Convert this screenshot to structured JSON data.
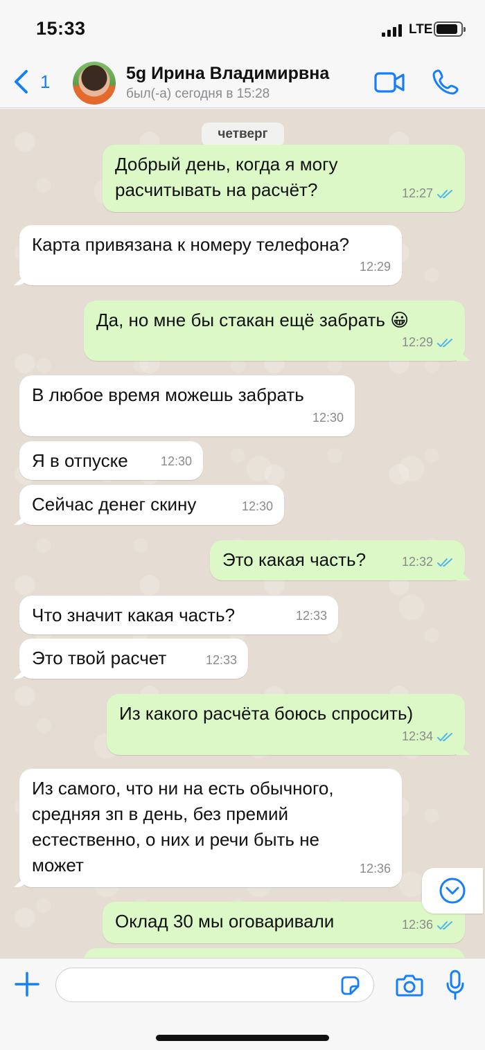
{
  "status_bar": {
    "time": "15:33",
    "network": "LTE"
  },
  "header": {
    "back_count": "1",
    "contact_name": "5g Ирина Владимирвна",
    "contact_status": "был(-а) сегодня в 15:28"
  },
  "chat": {
    "date_separator": "четверг",
    "messages": [
      {
        "dir": "out",
        "text": "Добрый день, когда я могу\nрасчитывать на расчёт?",
        "time": "12:27",
        "read": true
      },
      {
        "dir": "in",
        "text": "Карта привязана к номеру телефона?",
        "time": "12:29"
      },
      {
        "dir": "out",
        "text": "Да, но мне бы стакан ещё забрать 😀",
        "time": "12:29",
        "read": true
      },
      {
        "dir": "in",
        "text": "В любое время можешь забрать",
        "time": "12:30"
      },
      {
        "dir": "in",
        "text": "Я в отпуске",
        "time": "12:30"
      },
      {
        "dir": "in",
        "text": "Сейчас денег скину",
        "time": "12:30"
      },
      {
        "dir": "out",
        "text": "Это какая часть?",
        "time": "12:32",
        "read": true
      },
      {
        "dir": "in",
        "text": "Что значит какая часть?",
        "time": "12:33"
      },
      {
        "dir": "in",
        "text": "Это твой расчет",
        "time": "12:33"
      },
      {
        "dir": "out",
        "text": "Из какого расчёта боюсь спросить)",
        "time": "12:34",
        "read": true
      },
      {
        "dir": "in",
        "text": "Из самого, что ни на есть обычного,\nсредняя зп в день, без премий\nестественно, о них и речи быть не\nможет",
        "time": "12:36"
      },
      {
        "dir": "out",
        "text": "Оклад 30 мы оговаривали",
        "time": "12:36",
        "read": true
      }
    ]
  },
  "input": {
    "placeholder": "",
    "value": ""
  },
  "colors": {
    "accent": "#147efb",
    "outgoing_bubble": "#dcf8c6",
    "incoming_bubble": "#ffffff",
    "read_ticks": "#4fb6ec"
  },
  "icons": [
    "back-chevron-icon",
    "video-call-icon",
    "phone-call-icon",
    "scroll-down-icon",
    "plus-icon",
    "sticker-icon",
    "camera-icon",
    "microphone-icon"
  ]
}
